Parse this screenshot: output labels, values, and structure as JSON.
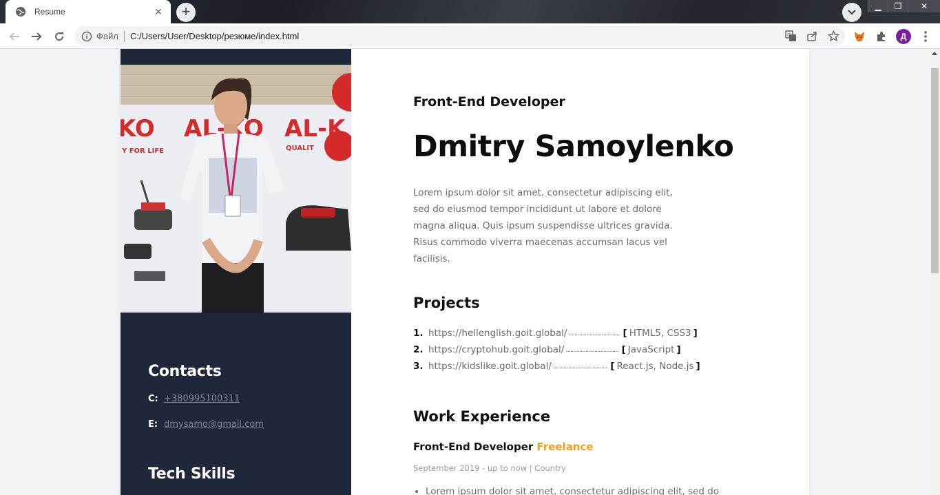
{
  "browser": {
    "tab_title": "Resume",
    "new_tab_label": "+",
    "scheme_label": "Файл",
    "url": "C:/Users/User/Desktop/резюме/index.html",
    "profile_initial": "Д"
  },
  "resume": {
    "role": "Front-End Developer",
    "name": "Dmitry Samoylenko",
    "about": "Lorem ipsum dolor sit amet, consectetur adipiscing elit, sed do eiusmod tempor incididunt ut labore et dolore magna aliqua. Quis ipsum suspendisse ultrices gravida. Risus commodo viverra maecenas accumsan lacus vel facilisis.",
    "projects_heading": "Projects",
    "projects": [
      {
        "num": "1.",
        "url": "https://hellenglish.goit.global/",
        "dots": "..................................",
        "tech": "HTML5, CSS3"
      },
      {
        "num": "2.",
        "url": "https://cryptohub.goit.global/",
        "dots": "...................................",
        "tech": "JavaScript"
      },
      {
        "num": "3.",
        "url": "https://kidslike.goit.global/",
        "dots": "....................................",
        "tech": "React.js, Node.js"
      }
    ],
    "bracket_open": "[",
    "bracket_close": "]",
    "experience_heading": "Work Experience",
    "job": {
      "title": "Front-End Developer",
      "company": "Freelance",
      "dates": "September 2019 - up to now | Country",
      "bullet": "Lorem ipsum dolor sit amet, consectetur adipiscing elit, sed do"
    },
    "contacts_heading": "Contacts",
    "contacts": [
      {
        "key": "C:",
        "value": "+380995100311"
      },
      {
        "key": "E:",
        "value": "dmysamo@gmail.com"
      }
    ],
    "skills_heading": "Tech Skills"
  },
  "colors": {
    "sidebar": "#1e2838",
    "accent": "#f59c1a",
    "profile": "#7b1fa2"
  }
}
